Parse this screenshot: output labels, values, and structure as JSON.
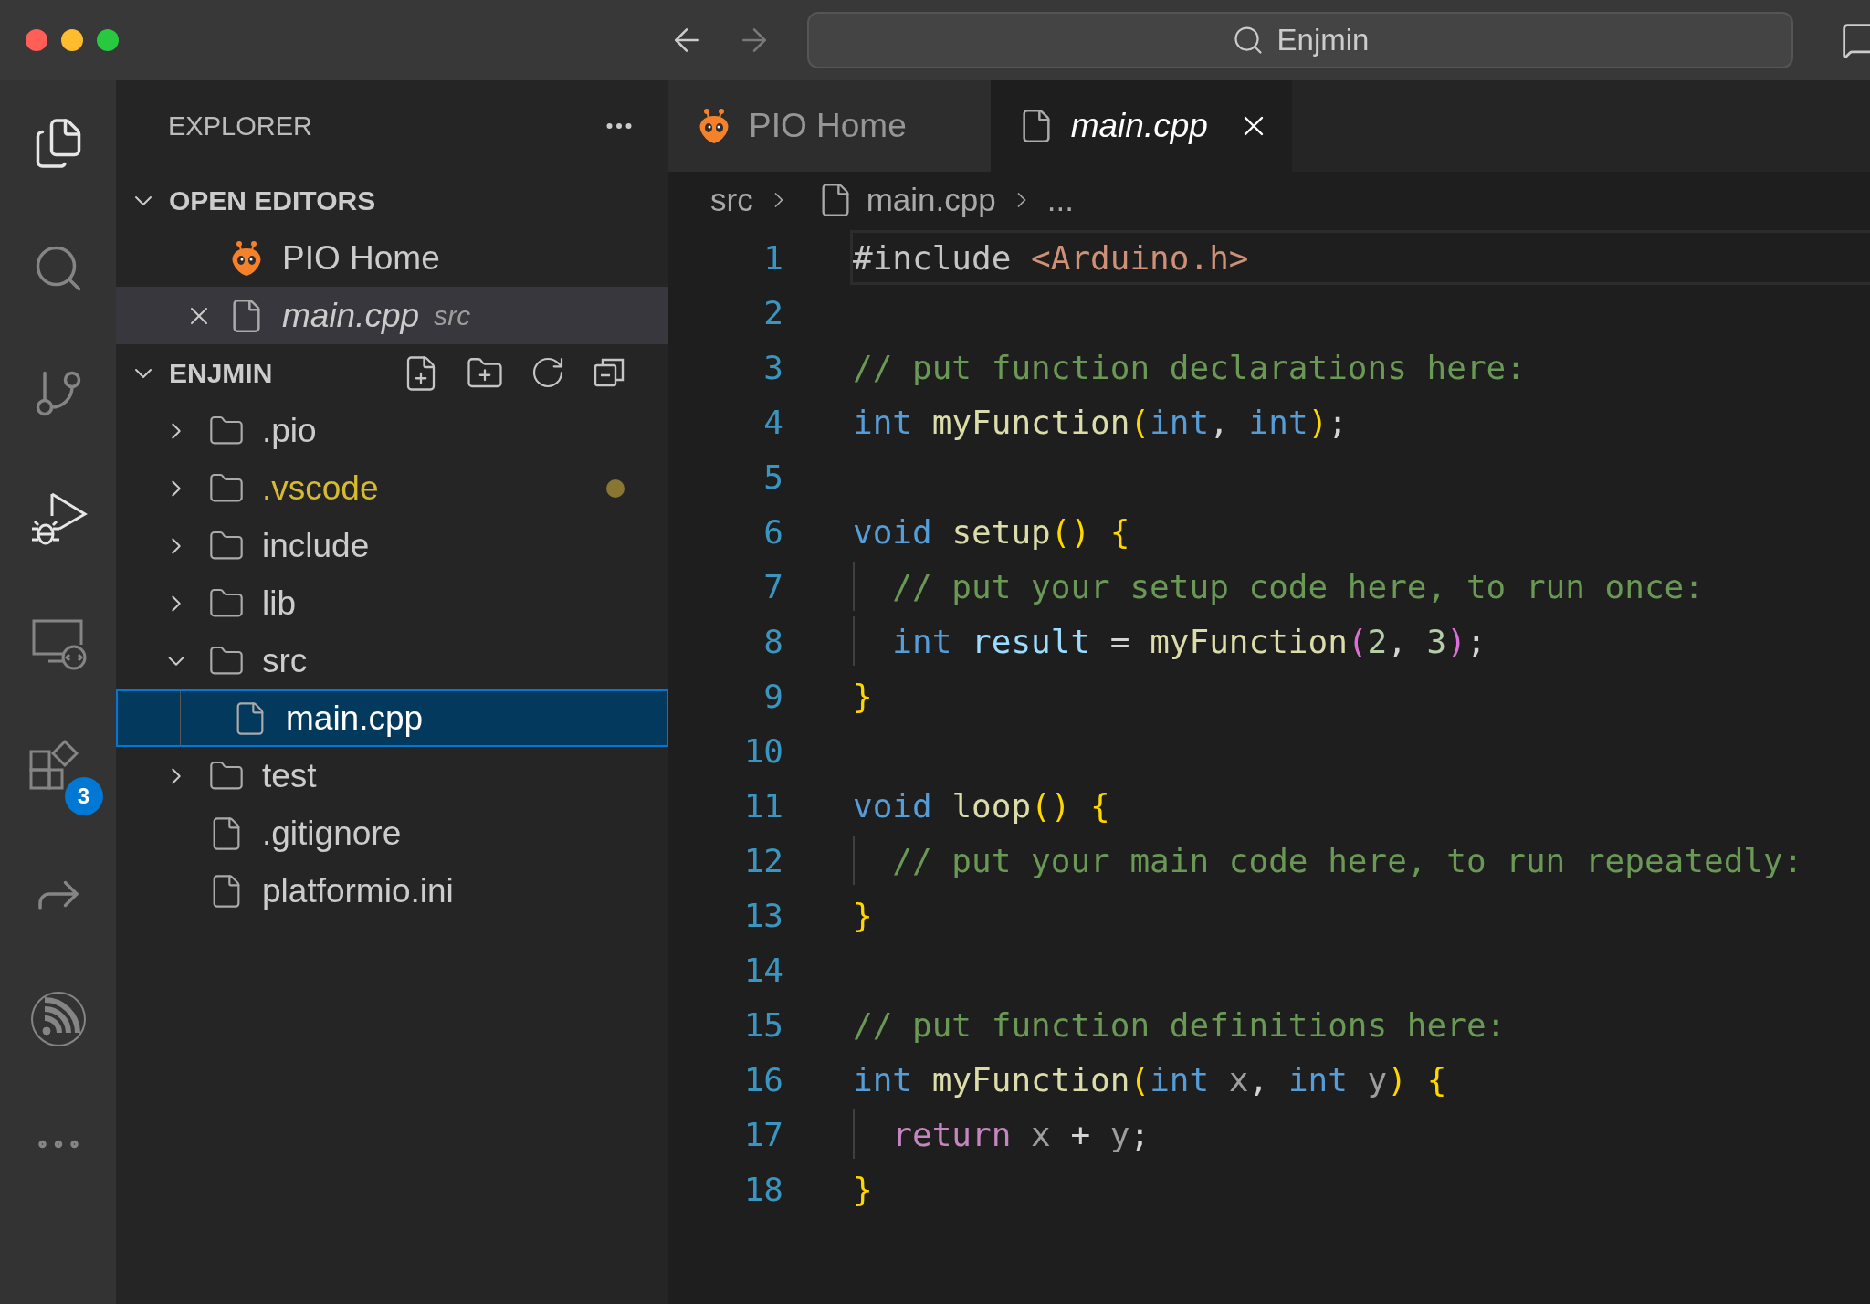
{
  "title_bar": {
    "search": "Enjmin",
    "back_enabled": true,
    "forward_enabled": false
  },
  "activity_bar": [
    {
      "kind": "files",
      "active": true
    },
    {
      "kind": "search",
      "active": false
    },
    {
      "kind": "source-control",
      "active": false
    },
    {
      "kind": "run-debug",
      "active": true
    },
    {
      "kind": "remote",
      "active": false
    },
    {
      "kind": "extensions",
      "active": false,
      "badge": "3"
    },
    {
      "kind": "share",
      "active": false
    },
    {
      "kind": "signal",
      "active": false
    },
    {
      "kind": "more",
      "active": false
    }
  ],
  "sidebar": {
    "title": "EXPLORER",
    "open_editors": {
      "title": "OPEN EDITORS",
      "expanded": true,
      "items": [
        {
          "label": "PIO Home",
          "kind": "pio",
          "active": false,
          "preview": false
        },
        {
          "label": "main.cpp",
          "kind": "file",
          "description": "src",
          "active": true,
          "preview": true
        }
      ]
    },
    "folder": {
      "title": "ENJMIN",
      "expanded": true,
      "tree": [
        {
          "label": ".pio",
          "kind": "folder",
          "expanded": false,
          "modified": false,
          "selected": false
        },
        {
          "label": ".vscode",
          "kind": "folder",
          "expanded": false,
          "modified": true,
          "selected": false
        },
        {
          "label": "include",
          "kind": "folder",
          "expanded": false,
          "modified": false,
          "selected": false
        },
        {
          "label": "lib",
          "kind": "folder",
          "expanded": false,
          "modified": false,
          "selected": false
        },
        {
          "label": "src",
          "kind": "folder",
          "expanded": true,
          "modified": false,
          "selected": false,
          "children": [
            {
              "label": "main.cpp",
              "kind": "file",
              "modified": false,
              "selected": true
            }
          ]
        },
        {
          "label": "test",
          "kind": "folder",
          "expanded": false,
          "modified": false,
          "selected": false
        },
        {
          "label": ".gitignore",
          "kind": "file",
          "modified": false,
          "selected": false
        },
        {
          "label": "platformio.ini",
          "kind": "file",
          "modified": false,
          "selected": false
        }
      ]
    }
  },
  "tabs": [
    {
      "label": "PIO Home",
      "kind": "pio",
      "selected": false,
      "preview": false
    },
    {
      "label": "main.cpp",
      "kind": "file",
      "selected": true,
      "preview": true
    }
  ],
  "breadcrumb": [
    {
      "label": "src",
      "kind": "folder"
    },
    {
      "label": "main.cpp",
      "kind": "file"
    },
    {
      "label": "...",
      "kind": "symbol"
    }
  ],
  "editor": {
    "lines": [
      {
        "number": "1",
        "current": true,
        "indented": false,
        "tokens": [
          {
            "text": "#include ",
            "kind": "pre"
          },
          {
            "text": "<Arduino.h>",
            "kind": "str"
          }
        ]
      },
      {
        "number": "2",
        "current": false,
        "indented": false
      },
      {
        "number": "3",
        "current": false,
        "indented": false,
        "tokens": [
          {
            "text": "// put function declarations here:",
            "kind": "comment"
          }
        ]
      },
      {
        "number": "4",
        "current": false,
        "indented": false,
        "tokens": [
          {
            "text": "int ",
            "kind": "kw"
          },
          {
            "text": "myFunction",
            "kind": "fn"
          },
          {
            "text": "(",
            "kind": "paren1"
          },
          {
            "text": "int",
            "kind": "kw"
          },
          {
            "text": ", ",
            "kind": "plain"
          },
          {
            "text": "int",
            "kind": "kw"
          },
          {
            "text": ")",
            "kind": "paren1"
          },
          {
            "text": ";",
            "kind": "plain"
          }
        ]
      },
      {
        "number": "5",
        "current": false,
        "indented": false
      },
      {
        "number": "6",
        "current": false,
        "indented": false,
        "tokens": [
          {
            "text": "void ",
            "kind": "kw"
          },
          {
            "text": "setup",
            "kind": "fn"
          },
          {
            "text": "() {",
            "kind": "paren1"
          }
        ]
      },
      {
        "number": "7",
        "current": false,
        "indented": true,
        "tokens": [
          {
            "text": "// put your setup code here, to run once:",
            "kind": "comment"
          }
        ]
      },
      {
        "number": "8",
        "current": false,
        "indented": true,
        "tokens": [
          {
            "text": "int ",
            "kind": "kw"
          },
          {
            "text": "result",
            "kind": "var"
          },
          {
            "text": " = ",
            "kind": "plain"
          },
          {
            "text": "myFunction",
            "kind": "fn"
          },
          {
            "text": "(",
            "kind": "paren2"
          },
          {
            "text": "2",
            "kind": "num"
          },
          {
            "text": ", ",
            "kind": "plain"
          },
          {
            "text": "3",
            "kind": "num"
          },
          {
            "text": ")",
            "kind": "paren2"
          },
          {
            "text": ";",
            "kind": "plain"
          }
        ]
      },
      {
        "number": "9",
        "current": false,
        "indented": false,
        "tokens": [
          {
            "text": "}",
            "kind": "paren1"
          }
        ]
      },
      {
        "number": "10",
        "current": false,
        "indented": false
      },
      {
        "number": "11",
        "current": false,
        "indented": false,
        "tokens": [
          {
            "text": "void ",
            "kind": "kw"
          },
          {
            "text": "loop",
            "kind": "fn"
          },
          {
            "text": "() {",
            "kind": "paren1"
          }
        ]
      },
      {
        "number": "12",
        "current": false,
        "indented": true,
        "tokens": [
          {
            "text": "// put your main code here, to run repeatedly:",
            "kind": "comment"
          }
        ]
      },
      {
        "number": "13",
        "current": false,
        "indented": false,
        "tokens": [
          {
            "text": "}",
            "kind": "paren1"
          }
        ]
      },
      {
        "number": "14",
        "current": false,
        "indented": false
      },
      {
        "number": "15",
        "current": false,
        "indented": false,
        "tokens": [
          {
            "text": "// put function definitions here:",
            "kind": "comment"
          }
        ]
      },
      {
        "number": "16",
        "current": false,
        "indented": false,
        "tokens": [
          {
            "text": "int ",
            "kind": "kw"
          },
          {
            "text": "myFunction",
            "kind": "fn"
          },
          {
            "text": "(",
            "kind": "paren1"
          },
          {
            "text": "int ",
            "kind": "kw"
          },
          {
            "text": "x",
            "kind": "param"
          },
          {
            "text": ", ",
            "kind": "plain"
          },
          {
            "text": "int ",
            "kind": "kw"
          },
          {
            "text": "y",
            "kind": "param"
          },
          {
            "text": ") {",
            "kind": "paren1"
          }
        ]
      },
      {
        "number": "17",
        "current": false,
        "indented": true,
        "tokens": [
          {
            "text": "return ",
            "kind": "ctrl"
          },
          {
            "text": "x",
            "kind": "param"
          },
          {
            "text": " + ",
            "kind": "plain"
          },
          {
            "text": "y",
            "kind": "param"
          },
          {
            "text": ";",
            "kind": "plain"
          }
        ]
      },
      {
        "number": "18",
        "current": false,
        "indented": false,
        "tokens": [
          {
            "text": "}",
            "kind": "paren1"
          }
        ]
      }
    ]
  }
}
